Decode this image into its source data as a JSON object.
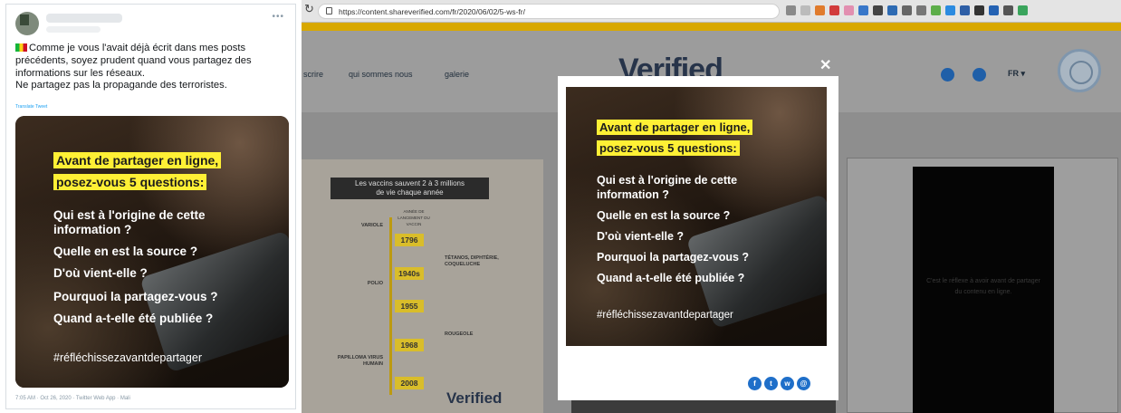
{
  "tweet": {
    "more": "•••",
    "text_lines": [
      "Comme je vous l'avait déjà écrit dans mes posts",
      "précédents, soyez prudent quand vous partagez des",
      "informations sur les réseaux.",
      "Ne partagez pas la propagande des terroristes."
    ],
    "translate": "Translate Tweet",
    "footer": "7:05 AM · Oct 26, 2020 · Twitter Web App · Mali"
  },
  "poster": {
    "headline_1": "Avant de partager en ligne,",
    "headline_2": "posez-vous 5 questions:",
    "questions": [
      "Qui est à l'origine de cette",
      "information ?",
      "Quelle en est la source ?",
      "D'où vient-elle ?",
      "Pourquoi la partagez-vous ?",
      "Quand a-t-elle été publiée ?"
    ],
    "hashtag": "#réfléchissezavantdepartager"
  },
  "browser": {
    "url": "https://content.shareverified.com/fr/2020/06/02/5-ws-fr/",
    "nav": [
      "scrire",
      "qui sommes nous",
      "galerie"
    ],
    "brand": "Verified",
    "lang": "FR",
    "close": "✕",
    "infographic": {
      "title_1": "Les vaccins sauvent 2 à 3 millions",
      "title_2": "de vie chaque année",
      "col_head": "ANNÉE DE LANCEMENT DU VACCIN",
      "years": [
        "1796",
        "1940s",
        "1955",
        "1968",
        "2008"
      ],
      "left": [
        "VARIOLE",
        "POLIO",
        "PAPILLOMA VIRUS HUMAIN"
      ],
      "right": [
        "TÉTANOS, DIPHTÉRIE, COQUELUCHE",
        "ROUGEOLE"
      ],
      "brand": "Verified"
    },
    "video_text": "C'est le réflexe à avoir avant de partager du contenu en ligne.",
    "share_icons": [
      "facebook-icon",
      "twitter-icon",
      "whatsapp-icon",
      "email-icon"
    ]
  },
  "colors": {
    "highlight": "#fff035",
    "brand": "#27344a",
    "accent": "#d8a800"
  }
}
